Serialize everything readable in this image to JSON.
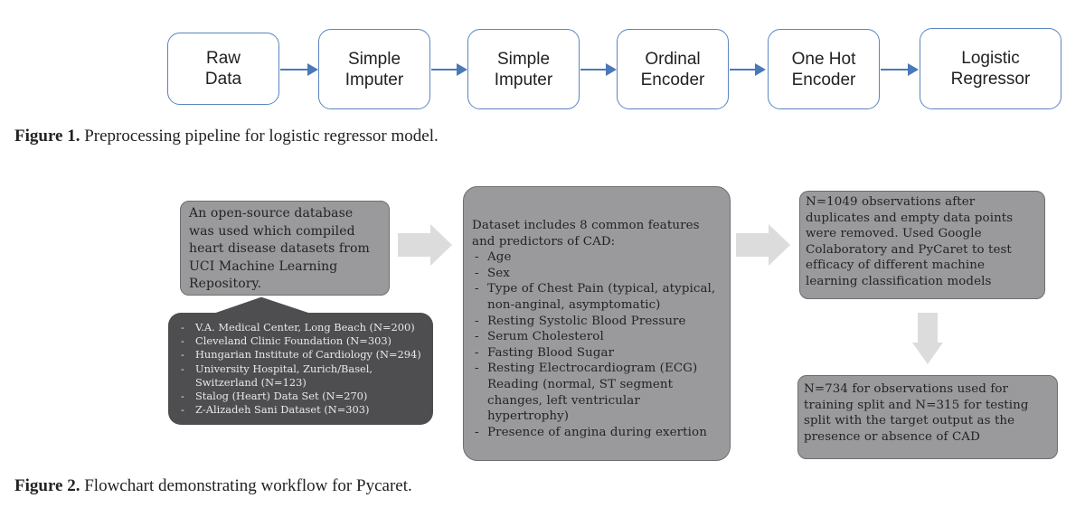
{
  "figure1": {
    "nodes": [
      {
        "label": "Raw\nData"
      },
      {
        "label": "Simple\nImputer"
      },
      {
        "label": "Simple\nImputer"
      },
      {
        "label": "Ordinal\nEncoder"
      },
      {
        "label": "One Hot\nEncoder"
      },
      {
        "label": "Logistic\nRegressor"
      }
    ],
    "caption_label": "Figure 1.",
    "caption_text": " Preprocessing pipeline for logistic regressor model.",
    "colors": {
      "border": "#5b85c0",
      "arrow": "#4a78b8"
    }
  },
  "figure2": {
    "source_box": {
      "text": "An open-source database was used which compiled heart disease datasets from UCI Machine Learning Repository."
    },
    "datasets_box": {
      "items": [
        "V.A. Medical Center, Long Beach (N=200)",
        "Cleveland Clinic Foundation (N=303)",
        "Hungarian Institute of Cardiology (N=294)",
        "University Hospital, Zurich/Basel, Switzerland (N=123)",
        "Stalog (Heart) Data Set (N=270)",
        "Z-Alizadeh Sani Dataset (N=303)"
      ]
    },
    "features_box": {
      "intro": "Dataset includes 8 common features and predictors of CAD:",
      "items": [
        "Age",
        "Sex",
        "Type of Chest Pain (typical, atypical, non-anginal, asymptomatic)",
        "Resting Systolic Blood Pressure",
        "Serum Cholesterol",
        "Fasting Blood Sugar",
        "Resting Electrocardiogram (ECG) Reading (normal, ST segment changes, left ventricular hypertrophy)",
        "Presence of angina during exertion"
      ]
    },
    "observations_box": {
      "text": "N=1049 observations after duplicates and empty data points were removed. Used Google Colaboratory and PyCaret to test efficacy of different machine learning classification models"
    },
    "split_box": {
      "text": "N=734 for observations used for training split and N=315 for testing split with the target output as the presence or absence of CAD"
    },
    "caption_label": "Figure 2.",
    "caption_text": " Flowchart demonstrating workflow for Pycaret.",
    "colors": {
      "box": "#9a9a9c",
      "dark_box": "#4e4e50",
      "arrow": "#dcdcdc"
    }
  }
}
